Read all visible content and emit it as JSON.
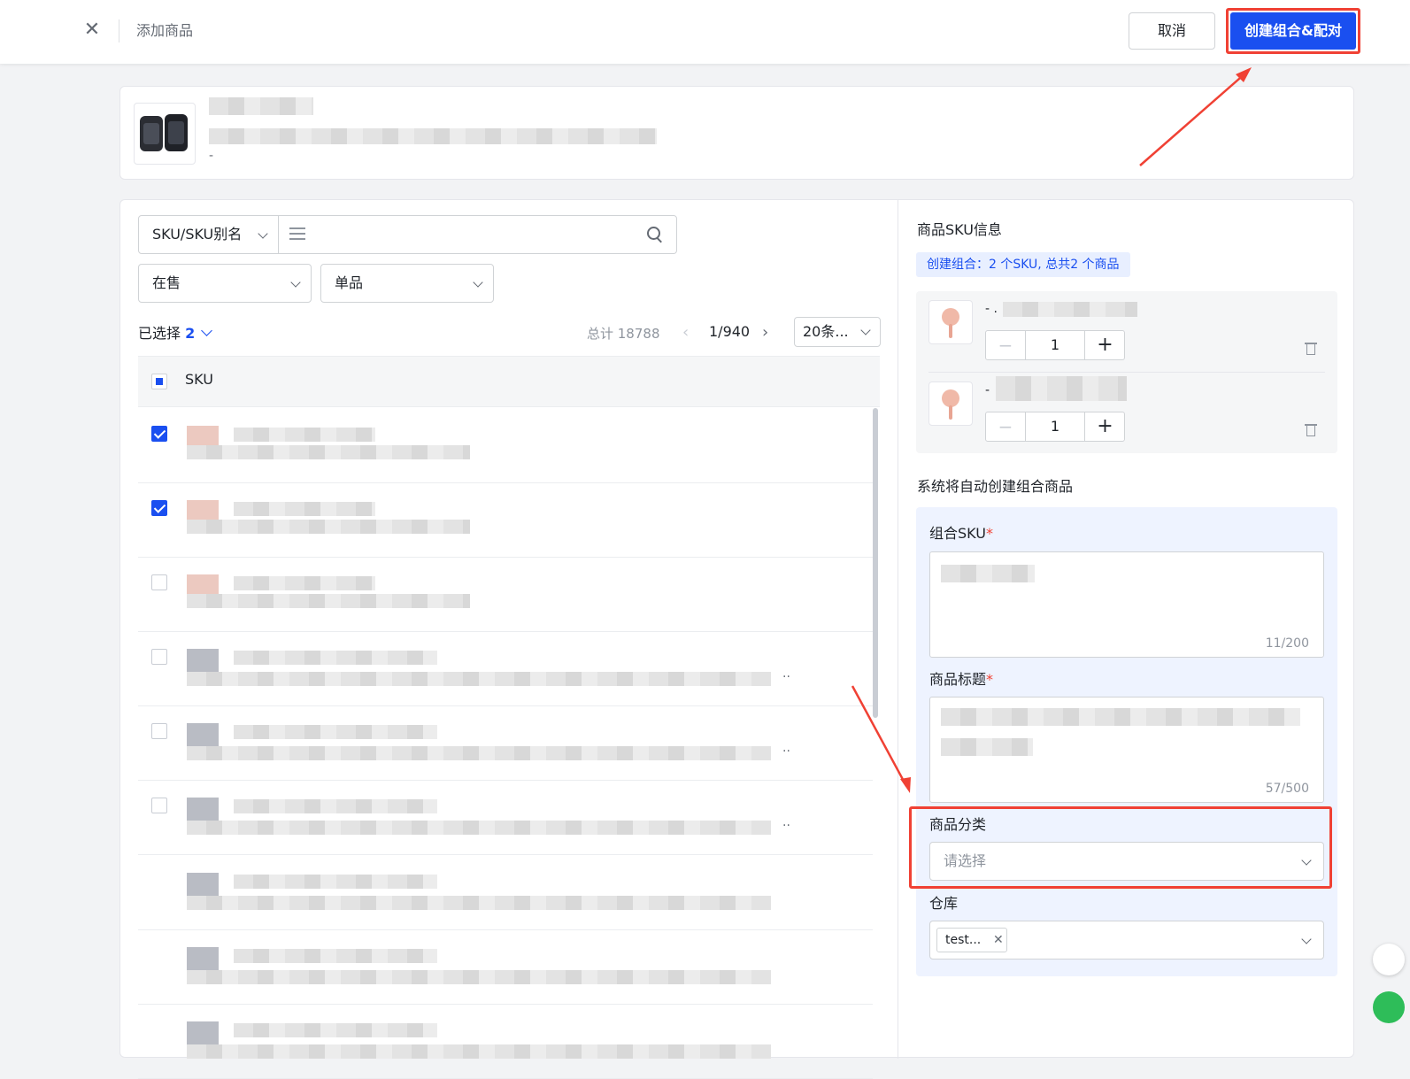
{
  "header": {
    "title": "添加商品",
    "cancel_label": "取消",
    "create_label": "创建组合&配对"
  },
  "product": {
    "sub_text": "-"
  },
  "filters": {
    "search_type": "SKU/SKU别名",
    "status": "在售",
    "type": "单品"
  },
  "list": {
    "selected_label": "已选择",
    "selected_count": "2",
    "total_label": "总计 18788",
    "page": "1/940",
    "page_size": "20条...",
    "column_sku": "SKU",
    "rows": [
      {
        "checked": true,
        "ellipsis": ""
      },
      {
        "checked": true,
        "ellipsis": ""
      },
      {
        "checked": false,
        "ellipsis": ""
      },
      {
        "checked": false,
        "ellipsis": ".."
      },
      {
        "checked": false,
        "ellipsis": ".."
      },
      {
        "checked": false,
        "ellipsis": ".."
      }
    ]
  },
  "sku_panel": {
    "title": "商品SKU信息",
    "tag": "创建组合：2 个SKU, 总共2 个商品",
    "items": [
      {
        "dash": "- .",
        "qty": "1"
      },
      {
        "dash": "-",
        "qty": "1"
      }
    ]
  },
  "auto_create": {
    "title": "系统将自动创建组合商品",
    "combo_sku_label": "组合SKU",
    "combo_sku_counter": "11/200",
    "product_title_label": "商品标题",
    "product_title_counter": "57/500",
    "category_label": "商品分类",
    "category_placeholder": "请选择",
    "warehouse_label": "仓库",
    "warehouse_tag": "test..."
  },
  "colors": {
    "primary": "#1a4ff0",
    "annotation_red": "#f04134",
    "tag_bg": "#e8efff"
  }
}
